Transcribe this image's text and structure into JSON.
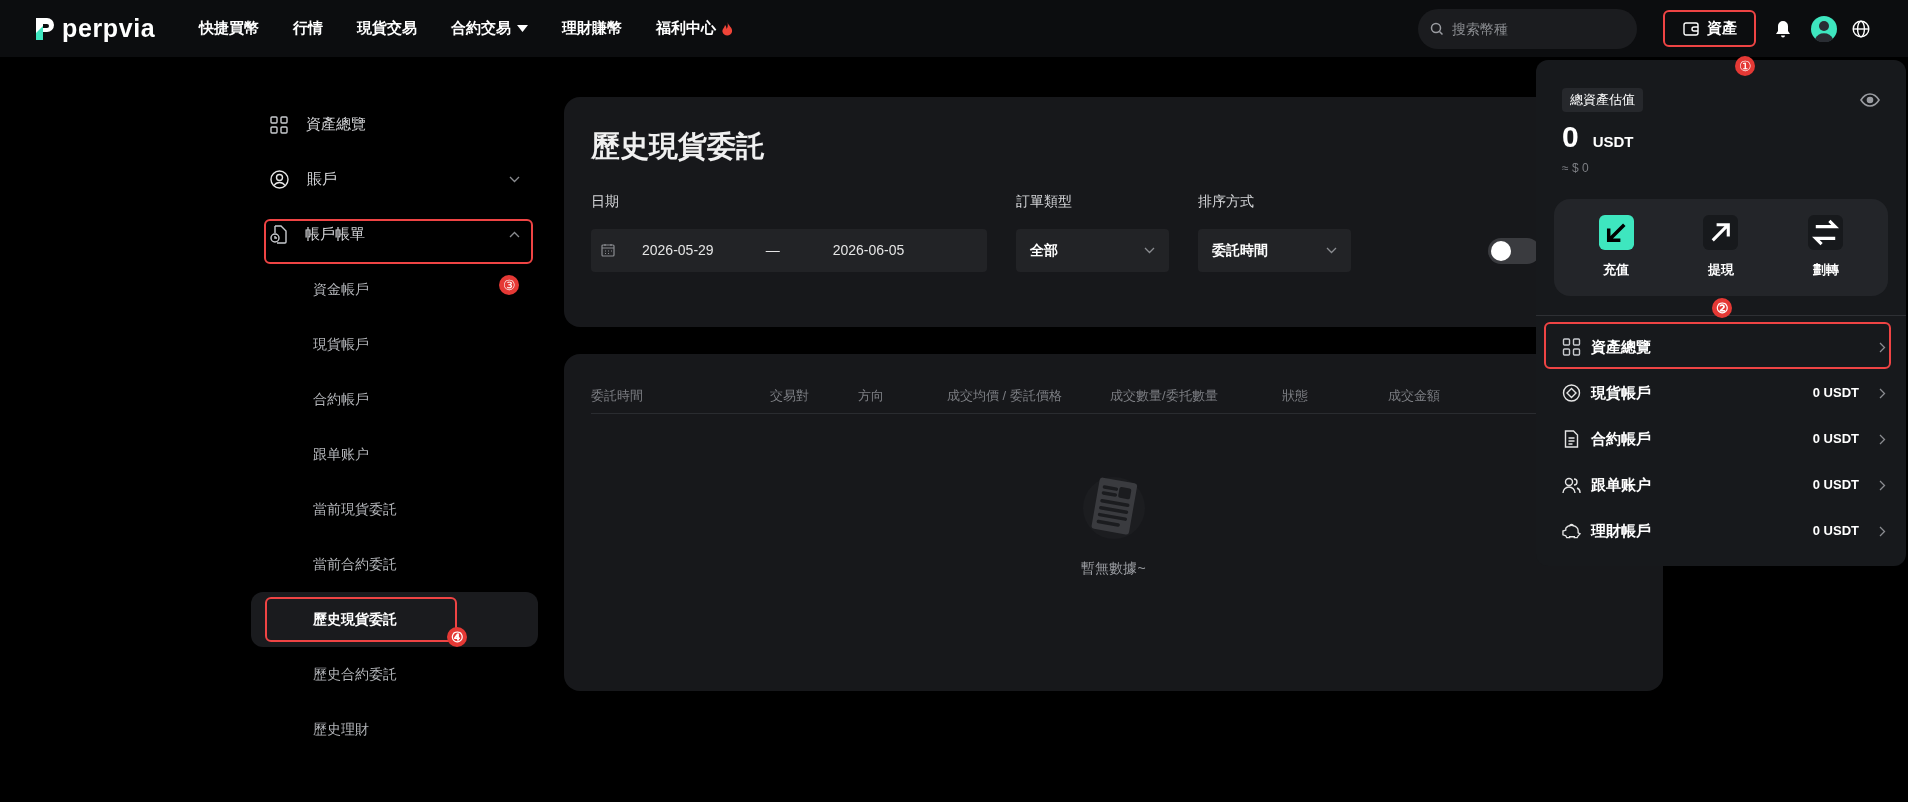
{
  "logo": {
    "text": "perpvia"
  },
  "nav": [
    {
      "label": "快捷買幣",
      "caret": false,
      "hot": false
    },
    {
      "label": "行情",
      "caret": false,
      "hot": false
    },
    {
      "label": "現貨交易",
      "caret": false,
      "hot": false
    },
    {
      "label": "合約交易",
      "caret": true,
      "hot": false
    },
    {
      "label": "理財賺幣",
      "caret": false,
      "hot": false
    },
    {
      "label": "福利中心",
      "caret": false,
      "hot": true
    }
  ],
  "search": {
    "placeholder": "搜索幣種"
  },
  "assets_button": {
    "label": "資產",
    "callout": "①"
  },
  "sidebar": {
    "items": [
      {
        "label": "資產總覽",
        "kind": "overview"
      },
      {
        "label": "賬戶",
        "kind": "account",
        "expanded": false
      },
      {
        "label": "帳戶帳單",
        "kind": "bill",
        "expanded": true,
        "callout": "③",
        "children": [
          {
            "label": "資金帳戶",
            "selected": false
          },
          {
            "label": "現貨帳戶",
            "selected": false
          },
          {
            "label": "合約帳戶",
            "selected": false
          },
          {
            "label": "跟单账户",
            "selected": false
          },
          {
            "label": "當前現貨委託",
            "selected": false
          },
          {
            "label": "當前合約委託",
            "selected": false
          },
          {
            "label": "歷史現貨委託",
            "selected": true,
            "callout": "④"
          },
          {
            "label": "歷史合約委託",
            "selected": false
          },
          {
            "label": "歷史理財",
            "selected": false
          }
        ]
      }
    ]
  },
  "page": {
    "title": "歷史現貨委託",
    "filters": [
      {
        "kind": "daterange",
        "label": "日期",
        "start": "2026-05-29",
        "separator": "—",
        "end": "2026-06-05"
      },
      {
        "kind": "select",
        "label": "訂單類型",
        "value": "全部"
      },
      {
        "kind": "select",
        "label": "排序方式",
        "value": "委託時間"
      },
      {
        "kind": "toggle",
        "on": false
      }
    ]
  },
  "table": {
    "columns": [
      "委託時間",
      "交易對",
      "方向",
      "成交均價 / 委託價格",
      "成交數量/委托數量",
      "狀態",
      "成交金額"
    ],
    "empty_text": "暫無數據~"
  },
  "assets_panel": {
    "badge": "總資產估值",
    "amount": "0",
    "unit": "USDT",
    "fiat": "≈ $ 0",
    "actions": [
      {
        "label": "充值",
        "kind": "deposit",
        "highlighted": true
      },
      {
        "label": "提現",
        "kind": "withdraw",
        "highlighted": false
      },
      {
        "label": "劃轉",
        "kind": "transfer",
        "highlighted": false
      }
    ],
    "rows": [
      {
        "label": "資產總覽",
        "kind": "overview",
        "callout": "②"
      },
      {
        "label": "現貨帳戶",
        "kind": "spot",
        "value": "0 USDT"
      },
      {
        "label": "合約帳戶",
        "kind": "futures",
        "value": "0 USDT"
      },
      {
        "label": "跟单账户",
        "kind": "copy",
        "value": "0 USDT"
      },
      {
        "label": "理財帳戶",
        "kind": "earn",
        "value": "0 USDT"
      }
    ]
  }
}
